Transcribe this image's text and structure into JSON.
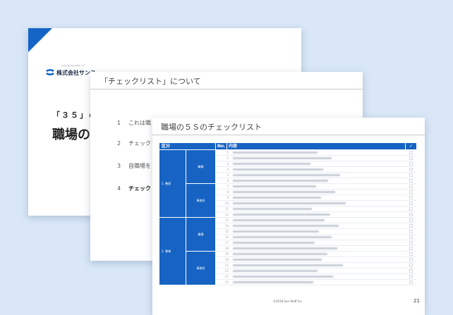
{
  "slide1": {
    "logo_text": "株式会社サンス",
    "logo_sub": "ジェイエスエスグループ",
    "subtitle": "「３５」の",
    "title": "職場の"
  },
  "slide2": {
    "title": "「チェックリスト」について",
    "items": [
      {
        "num": "1",
        "text": "これは職"
      },
      {
        "num": "2",
        "text": "チェック"
      },
      {
        "num": "3",
        "text": "自職場を"
      },
      {
        "num": "4",
        "text": "チェック"
      }
    ]
  },
  "slide3": {
    "title": "職場の５Ｓのチェックリスト",
    "columns": {
      "category": "区分",
      "no": "No.",
      "content": "内容",
      "check": "✓"
    },
    "groups": [
      {
        "name": "1. 整理",
        "subs": [
          {
            "name": "職場",
            "nums": [
              "1",
              "2",
              "3",
              "4",
              "5",
              "6"
            ]
          },
          {
            "name": "事務所",
            "nums": [
              "7",
              "8",
              "9",
              "10",
              "11",
              "12"
            ]
          }
        ]
      },
      {
        "name": "2. 整頓",
        "subs": [
          {
            "name": "職場",
            "nums": [
              "13",
              "14",
              "15",
              "16",
              "17",
              "18"
            ]
          },
          {
            "name": "事務所",
            "nums": [
              "19",
              "20",
              "21",
              "22",
              "23",
              "24"
            ]
          }
        ]
      }
    ],
    "footer": "©2018 Sun Staff Inc.",
    "page": "21"
  },
  "colors": {
    "background": "#d9e7f7",
    "accent": "#1465c6",
    "table_header": "#1663c3"
  }
}
